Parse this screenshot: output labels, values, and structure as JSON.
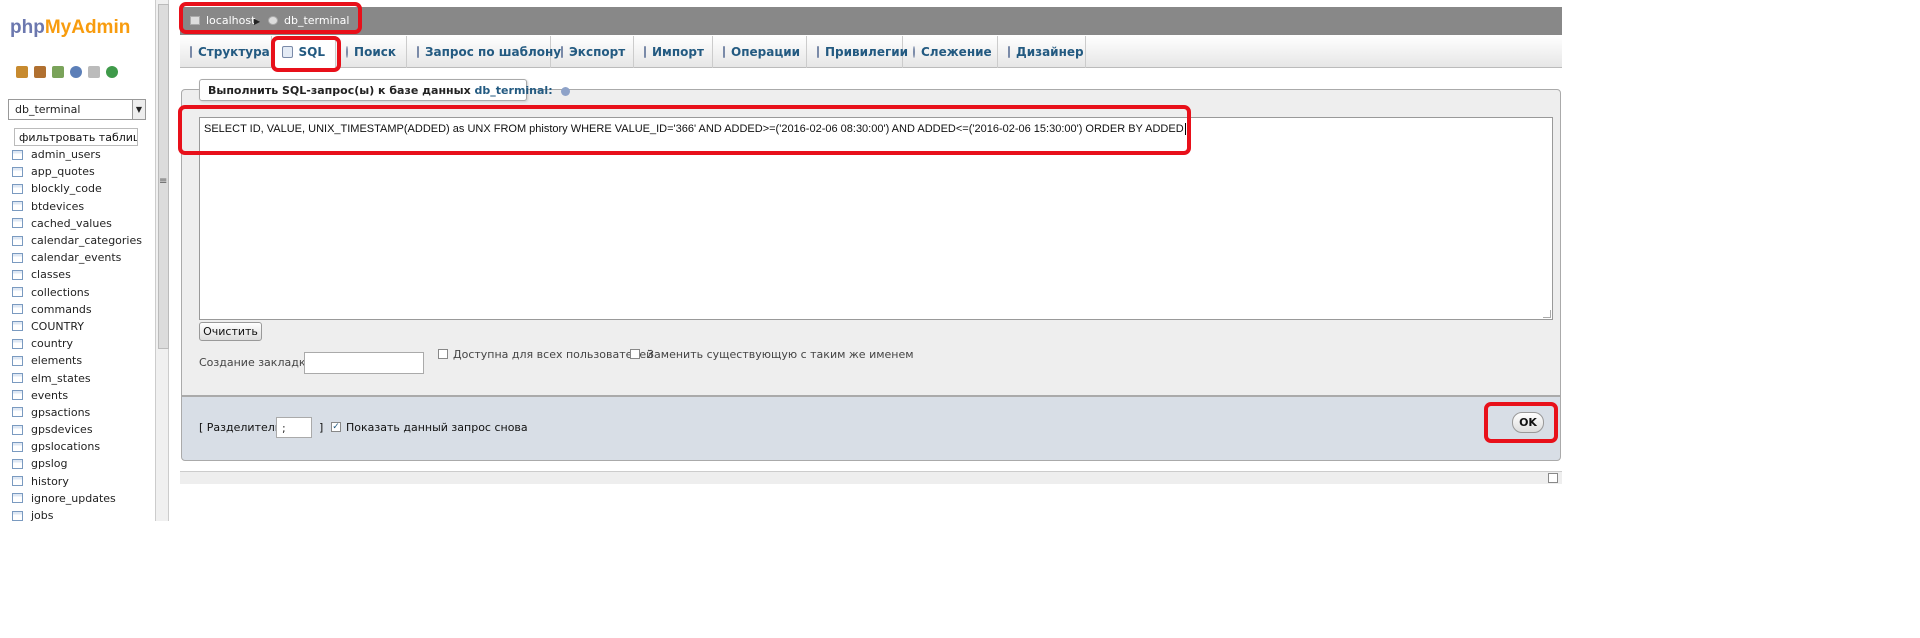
{
  "logo": {
    "php": "php",
    "myadmin": "MyAdmin"
  },
  "quick_icons": [
    "home-icon",
    "exit-icon",
    "query-window-icon",
    "docs-icon",
    "copy-icon",
    "reload-icon"
  ],
  "nav": {
    "database_select": "db_terminal",
    "filter_placeholder": "фильтровать таблицы по имени",
    "tables": [
      "admin_users",
      "app_quotes",
      "blockly_code",
      "btdevices",
      "cached_values",
      "calendar_categories",
      "calendar_events",
      "classes",
      "collections",
      "commands",
      "COUNTRY",
      "country",
      "elements",
      "elm_states",
      "events",
      "gpsactions",
      "gpsdevices",
      "gpslocations",
      "gpslog",
      "history",
      "ignore_updates",
      "jobs"
    ]
  },
  "breadcrumb": {
    "server": "localhost",
    "database": "db_terminal"
  },
  "tabs": [
    "Структура",
    "SQL",
    "Поиск",
    "Запрос по шаблону",
    "Экспорт",
    "Импорт",
    "Операции",
    "Привилегии",
    "Слежение",
    "Дизайнер"
  ],
  "active_tab": "SQL",
  "sql_form": {
    "legend_prefix": "Выполнить SQL-запрос(ы) к базе данных",
    "legend_db": "db_terminal:",
    "query": "SELECT ID, VALUE, UNIX_TIMESTAMP(ADDED) as UNX FROM phistory WHERE VALUE_ID='366' AND ADDED>=('2016-02-06 08:30:00') AND ADDED<=('2016-02-06 15:30:00') ORDER BY ADDED",
    "clear_button": "Очистить",
    "bookmark_label": "Создание закладки:",
    "bookmark_value": "",
    "public_label": "Доступна для всех пользователей",
    "replace_label": "Заменить существующую с таким же именем",
    "delimiter_open": "[ Разделитель",
    "delimiter_value": ";",
    "delimiter_close": "]",
    "show_query_label": "Показать данный запрос снова",
    "show_query_checked": true,
    "ok_button": "OK"
  },
  "colors": {
    "link": "#235a81",
    "highlight": "#e8101a",
    "breadcrumb_bg": "#888888"
  }
}
